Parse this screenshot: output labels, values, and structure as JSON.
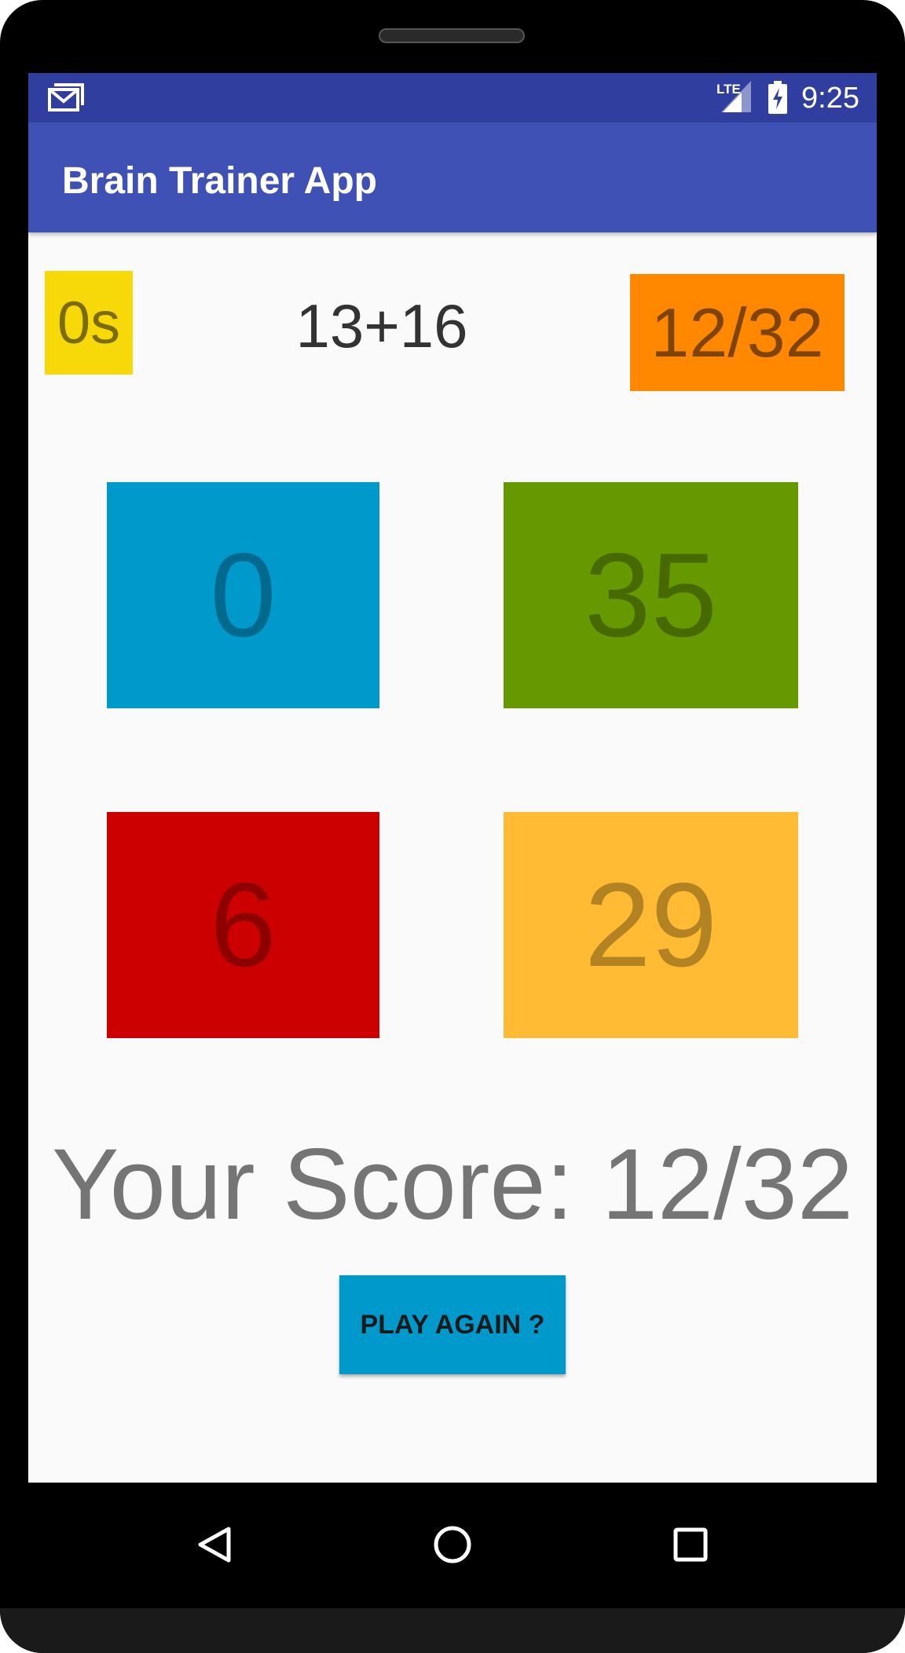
{
  "status_bar": {
    "time": "9:25",
    "network_label": "LTE",
    "icons": [
      "mail-icon",
      "lte-signal-icon",
      "battery-charging-icon"
    ]
  },
  "app_bar": {
    "title": "Brain Trainer App"
  },
  "game": {
    "timer": "0s",
    "question": "13+16",
    "score": "12/32",
    "answers": [
      "0",
      "35",
      "6",
      "29"
    ],
    "result": "Your Score: 12/32",
    "play_again_label": "PLAY AGAIN ?"
  },
  "nav_bar": {
    "icons": [
      "back-icon",
      "home-icon",
      "recents-icon"
    ]
  },
  "colors": {
    "status_bar": "#303f9f",
    "app_bar": "#3f51b5",
    "timer": "#f7d90a",
    "score": "#ff8800",
    "answer_0": "#0099cc",
    "answer_1": "#669900",
    "answer_2": "#cc0000",
    "answer_3": "#ffbb33",
    "play_button": "#0099cc"
  }
}
